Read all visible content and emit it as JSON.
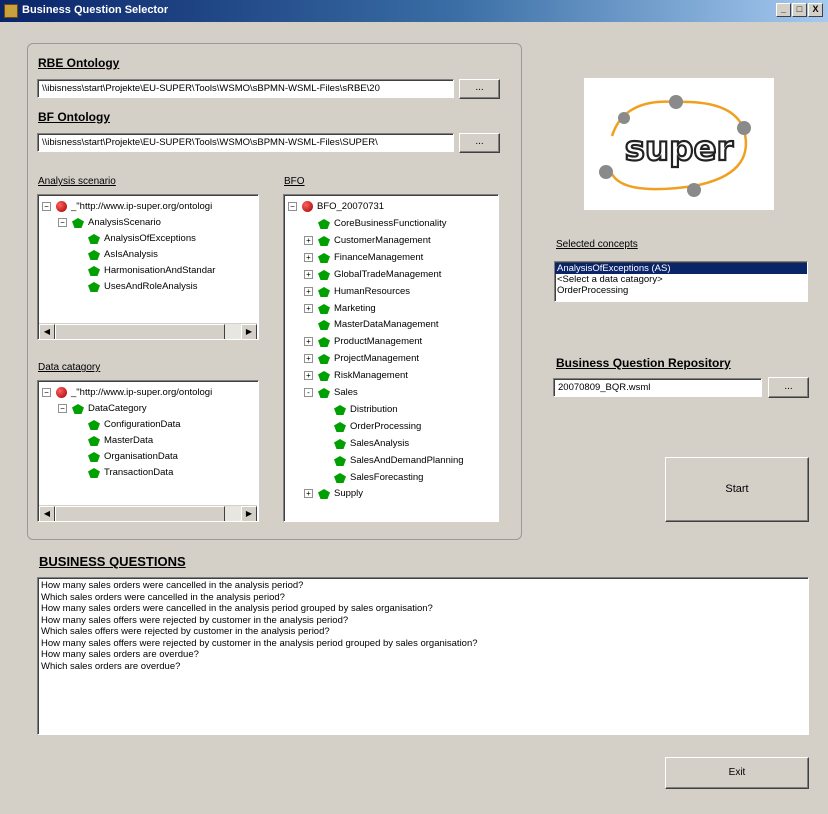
{
  "window": {
    "title": "Business Question Selector",
    "controls": [
      "_",
      "□",
      "X"
    ]
  },
  "rbe": {
    "heading": "RBE Ontology",
    "path": "\\\\ibisness\\start\\Projekte\\EU-SUPER\\Tools\\WSMO\\sBPMN-WSML-Files\\sRBE\\20",
    "browse": "..."
  },
  "bf": {
    "heading": "BF Ontology",
    "path": "\\\\ibisness\\start\\Projekte\\EU-SUPER\\Tools\\WSMO\\sBPMN-WSML-Files\\SUPER\\",
    "browse": "..."
  },
  "analysis": {
    "label": "Analysis scenario",
    "root": "_\"http://www.ip-super.org/ontologi",
    "node": "AnalysisScenario",
    "items": [
      "AnalysisOfExceptions",
      "AsIsAnalysis",
      "HarmonisationAndStandar",
      "UsesAndRoleAnalysis"
    ]
  },
  "data_category": {
    "label": "Data catagory",
    "root": "_\"http://www.ip-super.org/ontologi",
    "node": "DataCategory",
    "items": [
      "ConfigurationData",
      "MasterData",
      "OrganisationData",
      "TransactionData"
    ]
  },
  "bfo": {
    "label": "BFO",
    "root": "BFO_20070731",
    "items": [
      {
        "label": "CoreBusinessFunctionality",
        "level": 1,
        "expand": ""
      },
      {
        "label": "CustomerManagement",
        "level": 1,
        "expand": "+"
      },
      {
        "label": "FinanceManagement",
        "level": 1,
        "expand": "+"
      },
      {
        "label": "GlobalTradeManagement",
        "level": 1,
        "expand": "+"
      },
      {
        "label": "HumanResources",
        "level": 1,
        "expand": "+"
      },
      {
        "label": "Marketing",
        "level": 1,
        "expand": "+"
      },
      {
        "label": "MasterDataManagement",
        "level": 1,
        "expand": ""
      },
      {
        "label": "ProductManagement",
        "level": 1,
        "expand": "+"
      },
      {
        "label": "ProjectManagement",
        "level": 1,
        "expand": "+"
      },
      {
        "label": "RiskManagement",
        "level": 1,
        "expand": "+"
      },
      {
        "label": "Sales",
        "level": 1,
        "expand": "-"
      },
      {
        "label": "Distribution",
        "level": 2,
        "expand": ""
      },
      {
        "label": "OrderProcessing",
        "level": 2,
        "expand": ""
      },
      {
        "label": "SalesAnalysis",
        "level": 2,
        "expand": ""
      },
      {
        "label": "SalesAndDemandPlanning",
        "level": 2,
        "expand": ""
      },
      {
        "label": "SalesForecasting",
        "level": 2,
        "expand": ""
      },
      {
        "label": "Supply",
        "level": 1,
        "expand": "+"
      }
    ]
  },
  "logo": {
    "text": "super"
  },
  "selected": {
    "label": "Selected concepts",
    "items": [
      "AnalysisOfExceptions (AS)",
      "<Select a data catagory>",
      "OrderProcessing"
    ],
    "selected_index": 0
  },
  "repository": {
    "heading": "Business Question Repository",
    "value": "20070809_BQR.wsml",
    "browse": "..."
  },
  "start_label": "Start",
  "questions": {
    "heading": "BUSINESS QUESTIONS",
    "lines": [
      "How many sales orders were cancelled in the analysis period?",
      "Which sales orders were cancelled in the analysis period?",
      "How many sales orders were cancelled in the analysis period grouped by sales organisation?",
      "How many sales offers were rejected by customer in the analysis period?",
      "Which sales offers were rejected by customer in the analysis period?",
      "How many sales offers were rejected by customer in the analysis period grouped by sales organisation?",
      "How many sales orders are overdue?",
      "Which sales orders are overdue?"
    ]
  },
  "exit_label": "Exit",
  "colors": {
    "title_start": "#0a246a",
    "title_end": "#a6caf0",
    "node_green": "#00a000",
    "node_red": "#c00000",
    "selection": "#0a246a",
    "logo_orange": "#f0a020"
  }
}
